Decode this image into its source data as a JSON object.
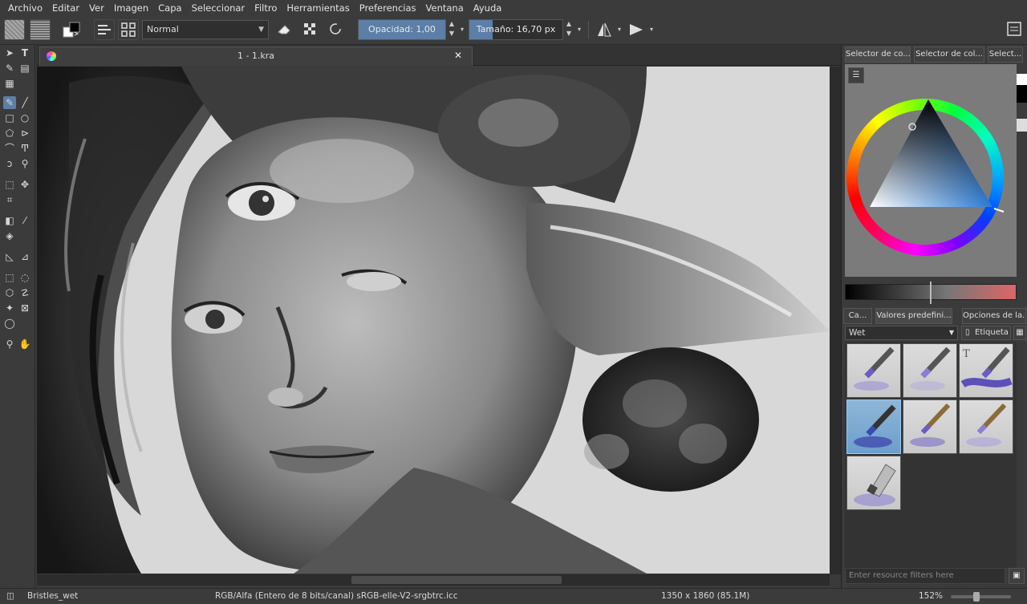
{
  "menu": [
    "Archivo",
    "Editar",
    "Ver",
    "Imagen",
    "Capa",
    "Seleccionar",
    "Filtro",
    "Herramientas",
    "Preferencias",
    "Ventana",
    "Ayuda"
  ],
  "toolbar": {
    "blend_mode": "Normal",
    "opacity_label": "Opacidad:  1,00",
    "opacity_value": 1.0,
    "size_label": "Tamaño:  16,70 px",
    "size_fraction": 0.25
  },
  "document": {
    "tab_title": "1 - 1.kra"
  },
  "dock": {
    "tabs": [
      "Selector de co...",
      "Selector de col...",
      "Select..."
    ],
    "preset_tabs": [
      "Ca...",
      "Valores predefini...",
      "Opciones de la..."
    ],
    "tag_select": "Wet",
    "tag_button": "Etiqueta",
    "filter_placeholder": "Enter resource filters here"
  },
  "colors": {
    "accent": "#5b7fa6",
    "background": "#3b3b3b",
    "canvas": "#d9d9d9"
  },
  "status": {
    "brush": "Bristles_wet",
    "color_model": "RGB/Alfa (Entero de 8 bits/canal)  sRGB-elle-V2-srgbtrc.icc",
    "dimensions": "1350 x 1860 (85.1M)",
    "zoom": "152%"
  }
}
